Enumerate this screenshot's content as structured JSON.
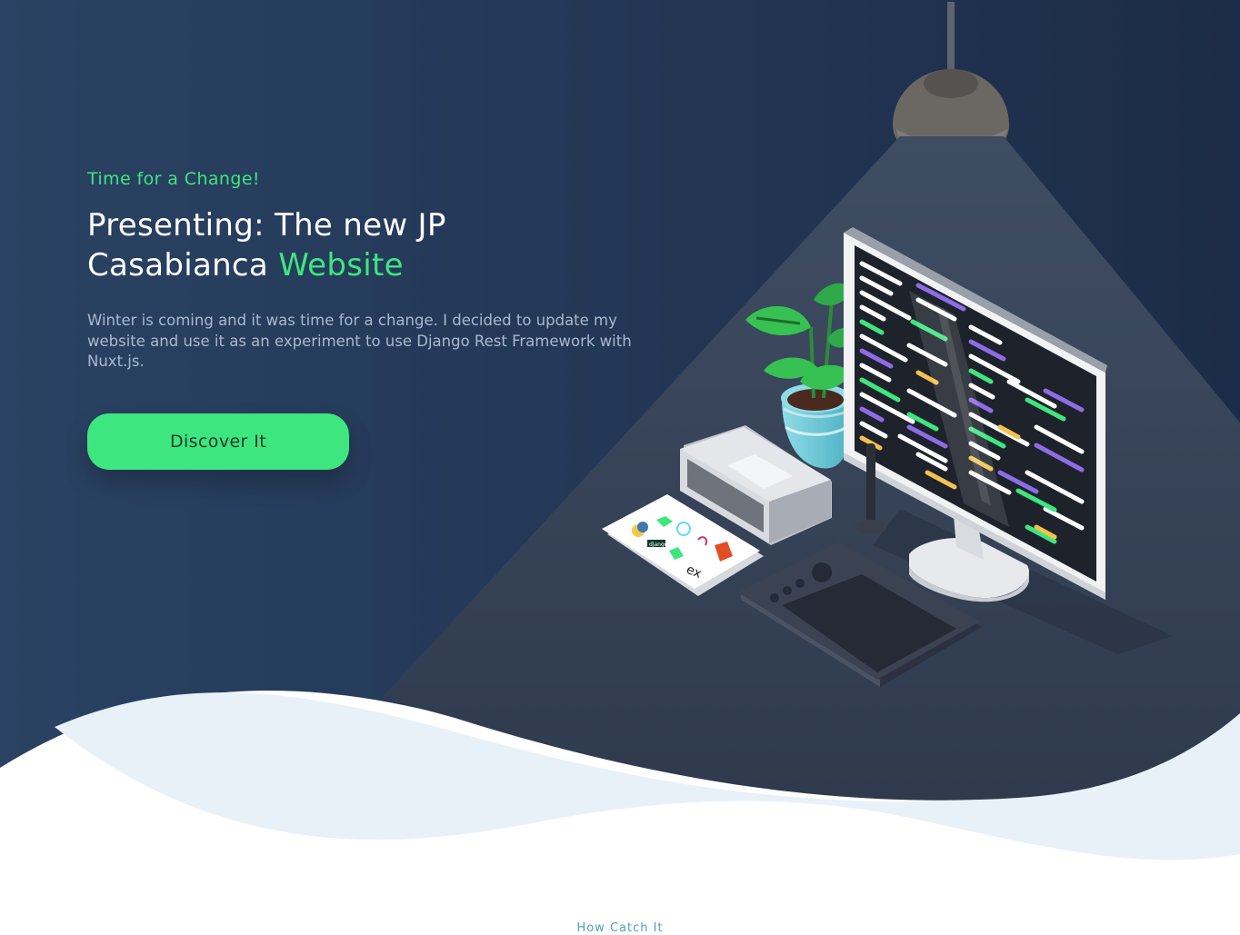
{
  "hero": {
    "eyebrow": "Time for a Change!",
    "title_line1": "Presenting: The new JP",
    "title_line2_lead": "Casabianca",
    "title_line2_accent": "Website",
    "intro": "Winter is coming and it was time for a change. I decided to update my website and use it as an experiment to use Django Rest Framework with Nuxt.js.",
    "cta_label": "Discover It"
  },
  "illustration": {
    "card_text": [
      "ex"
    ],
    "card_badge": "django"
  },
  "footer": {
    "link_text": "How Catch It"
  },
  "colors": {
    "accent": "#3ee67f",
    "navy": "#233552",
    "wave": "#e8f1f8"
  }
}
